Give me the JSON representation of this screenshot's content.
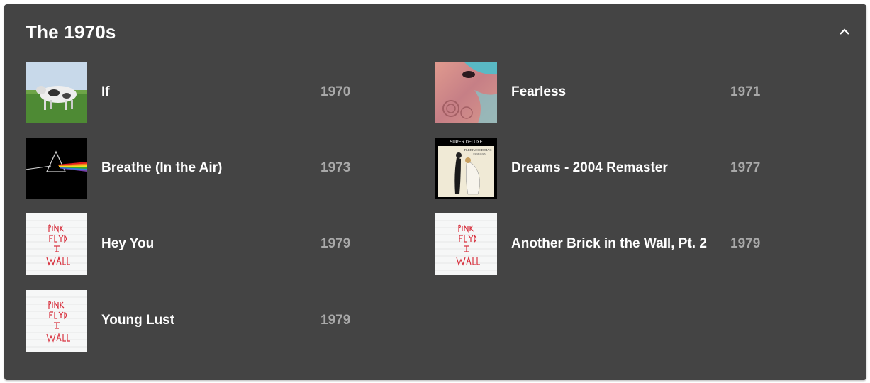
{
  "section": {
    "title": "The 1970s",
    "collapse_icon": "chevron-up-icon"
  },
  "tracks": [
    {
      "title": "If",
      "year": "1970",
      "cover": "atom-heart-mother-cover"
    },
    {
      "title": "Fearless",
      "year": "1971",
      "cover": "meddle-cover"
    },
    {
      "title": "Breathe (In the Air)",
      "year": "1973",
      "cover": "dark-side-of-the-moon-cover"
    },
    {
      "title": "Dreams - 2004 Remaster",
      "year": "1977",
      "cover": "rumours-cover"
    },
    {
      "title": "Hey You",
      "year": "1979",
      "cover": "the-wall-cover"
    },
    {
      "title": "Another Brick in the Wall, Pt. 2",
      "year": "1979",
      "cover": "the-wall-cover"
    },
    {
      "title": "Young Lust",
      "year": "1979",
      "cover": "the-wall-cover"
    }
  ],
  "cover_text": {
    "rumours_top": "SUPER DELUXE",
    "rumours_band": "FLEETWOOD MAC",
    "rumours_album": "RUMOURS"
  },
  "colors": {
    "card_background": "#444444",
    "title_text": "#ffffff",
    "year_text": "#a9a9a9",
    "wall_lettering": "#d8323f"
  }
}
